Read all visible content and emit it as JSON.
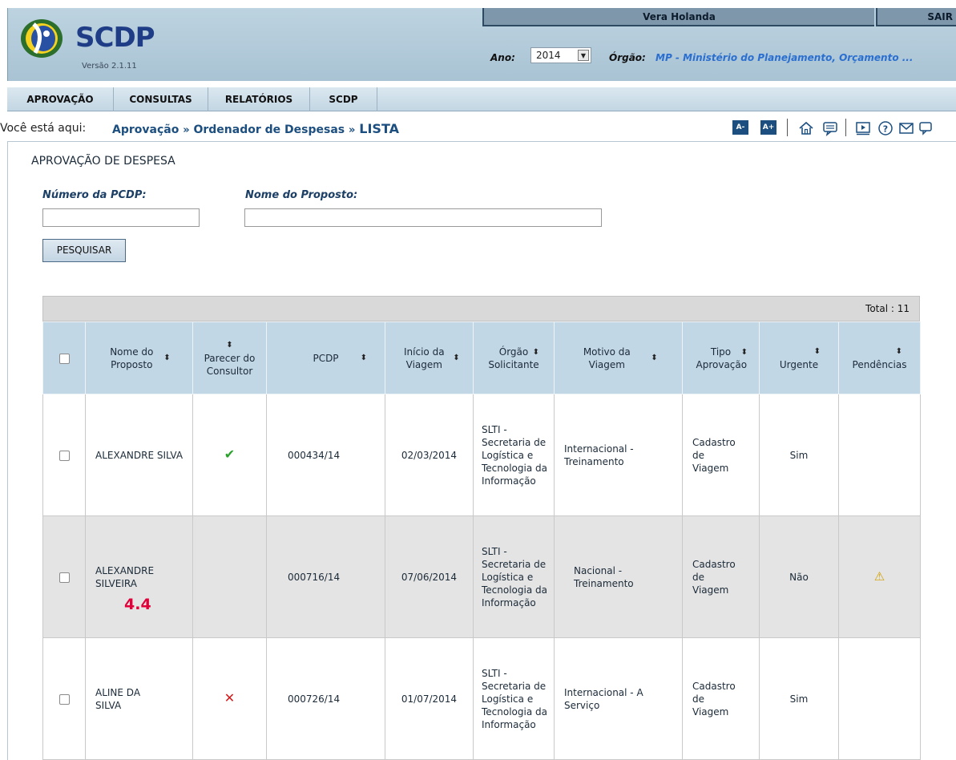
{
  "header": {
    "logo_title": "SCDP",
    "version": "Versão 2.1.11",
    "user_name": "Vera Holanda",
    "logout_label": "SAIR",
    "ano_label": "Ano:",
    "ano_value": "2014",
    "orgao_label": "Órgão:",
    "orgao_value": "MP - Ministério do Planejamento, Orçamento ..."
  },
  "nav": {
    "items": [
      {
        "label": "APROVAÇÃO"
      },
      {
        "label": "CONSULTAS"
      },
      {
        "label": "RELATÓRIOS"
      },
      {
        "label": "SCDP"
      }
    ]
  },
  "breadcrumb": {
    "lead": "Você está aqui:",
    "items": [
      "Aprovação",
      "Ordenador de Despesas",
      "LISTA"
    ],
    "separator": "»"
  },
  "toolbar": {
    "font_decrease": "A-",
    "font_increase": "A+",
    "icons": [
      "home-icon",
      "comment-icon",
      "presentation-icon",
      "help-icon",
      "mail-icon",
      "chat-icon"
    ]
  },
  "page": {
    "section_title": "APROVAÇÃO DE DESPESA",
    "numero_label": "Número da PCDP:",
    "numero_value": "",
    "nome_label": "Nome do Proposto:",
    "nome_value": "",
    "search_button": "PESQUISAR"
  },
  "table": {
    "total": "Total : 11",
    "headers": {
      "nome": "Nome do Proposto",
      "parecer": "Parecer do Consultor",
      "pcdp": "PCDP",
      "inicio": "Início da Viagem",
      "orgao": "Órgão Solicitante",
      "motivo": "Motivo da Viagem",
      "tipo": "Tipo Aprovação",
      "urgente": "Urgente",
      "pendencias": "Pendências"
    },
    "rows": [
      {
        "nome": "ALEXANDRE SILVA",
        "parecer": "✔",
        "pcdp": "000434/14",
        "inicio": "02/03/2014",
        "orgao": "SLTI - Secretaria de Logística e Tecnologia da Informação",
        "motivo": "Internacional - Treinamento",
        "tipo": "Cadastro de Viagem",
        "urgente": "Sim",
        "pendencias": ""
      },
      {
        "nome": "ALEXANDRE SILVEIRA",
        "parecer": "",
        "pcdp": "000716/14",
        "inicio": "07/06/2014",
        "orgao": "SLTI - Secretaria de Logística e Tecnologia da Informação",
        "motivo": "Nacional - Treinamento",
        "tipo": "Cadastro de Viagem",
        "urgente": "Não",
        "pendencias": "⚠"
      },
      {
        "nome": "ALINE DA SILVA",
        "parecer": "✕",
        "pcdp": "000726/14",
        "inicio": "01/07/2014",
        "orgao": "SLTI - Secretaria de Logística e Tecnologia da Informação",
        "motivo": "Internacional - A Serviço",
        "tipo": "Cadastro de Viagem",
        "urgente": "Sim",
        "pendencias": ""
      }
    ]
  },
  "annotation": "4.4",
  "colors": {
    "header_bg": "#a9c3d4",
    "nav_bg": "#c2d6e3",
    "table_header_bg": "#c2d7e6",
    "link_blue": "#1c4f80",
    "annotation_red": "#e0003a",
    "check_green": "#2aa12a",
    "cross_red": "#d51a1a"
  }
}
